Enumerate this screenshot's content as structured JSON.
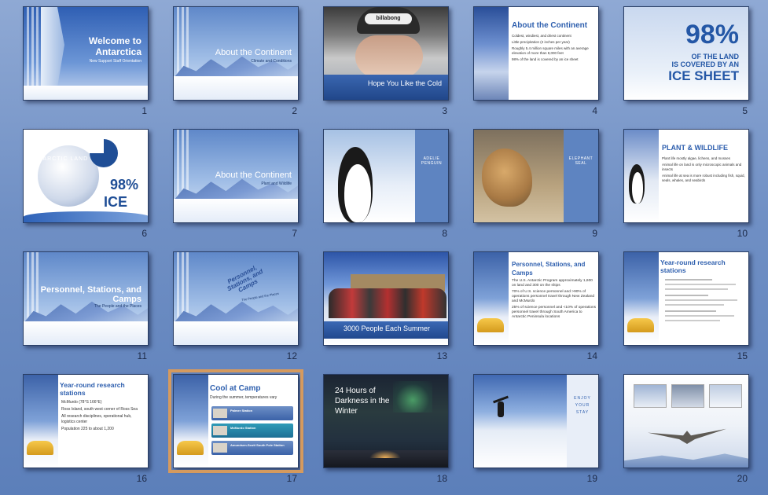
{
  "slides": [
    {
      "number": "1",
      "title": "Welcome to Antarctica",
      "subtitle": "New Support Staff Orientation"
    },
    {
      "number": "2",
      "title": "About the Continent",
      "subtitle": "Climate and Conditions"
    },
    {
      "number": "3",
      "title": "Hope You Like the Cold",
      "hat_text": "billabong"
    },
    {
      "number": "4",
      "title": "About the Continent",
      "bullets": [
        "Coldest, windiest, and driest continent",
        "Little precipitation (2 inches per year)",
        "Roughly 5.4 million square miles with an average elevation of more than 8,000 feet",
        "98% of the land is covered by an ice sheet"
      ]
    },
    {
      "number": "5",
      "big": "98%",
      "line1": "OF THE LAND",
      "line2": "IS COVERED BY AN",
      "line3": "ICE SHEET"
    },
    {
      "number": "6",
      "label": "ANTARCTIC LAND",
      "big": "98%",
      "big2": "ICE"
    },
    {
      "number": "7",
      "title": "About the Continent",
      "subtitle": "Plant and Wildlife"
    },
    {
      "number": "8",
      "title": "ADELIE PENGUIN"
    },
    {
      "number": "9",
      "title": "ELEPHANT SEAL"
    },
    {
      "number": "10",
      "title": "PLANT & WILDLIFE",
      "bullets": [
        "Plant life mostly algae, lichens, and mosses",
        "Animal life on land is only microscopic animals and insects",
        "Animal life at sea is more robust including fish, squid, seals, whales, and seabirds"
      ]
    },
    {
      "number": "11",
      "title": "Personnel, Stations, and Camps",
      "subtitle": "The People and the Places"
    },
    {
      "number": "12",
      "title": "Personnel, Stations, and Camps",
      "subtitle": "The People and the Places"
    },
    {
      "number": "13",
      "title": "3000 People Each Summer"
    },
    {
      "number": "14",
      "title": "Personnel, Stations, and Camps",
      "bullets": [
        "The U.S. Antarctic Program approximately 1,600 on land and 300 on the ships",
        "70% of U.S. science personnel and >90% of operations personnel travel through New Zealand and McMurdo",
        "25% of science personnel and <10% of operations personnel travel through South America to Antarctic Peninsula locations"
      ]
    },
    {
      "number": "15",
      "title": "Year-round research stations"
    },
    {
      "number": "16",
      "title": "Year-round research stations",
      "bullets": [
        "McMurdo (78°S 166°E)",
        "Ross Island, south west corner of Ross Sea",
        "All research disciplines, operational hub, logistics center",
        "Population 225 to about 1,200"
      ]
    },
    {
      "number": "17",
      "title": "Cool at Camp",
      "subtitle": "During the summer, temperatures vary",
      "rows": [
        "Palmer Station",
        "McMurdo Station",
        "Amundsen-Scott South Pole Station"
      ]
    },
    {
      "number": "18",
      "title": "24 Hours of Darkness in the Winter"
    },
    {
      "number": "19",
      "title": "ENJOY YOUR STAY"
    },
    {
      "number": "20"
    }
  ],
  "selected_slide": "17"
}
